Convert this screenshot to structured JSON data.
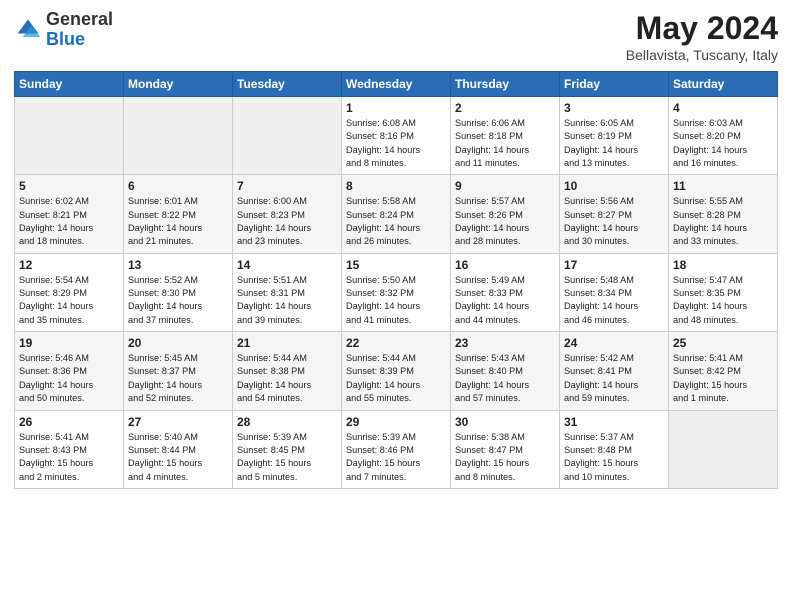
{
  "logo": {
    "general": "General",
    "blue": "Blue"
  },
  "title": "May 2024",
  "subtitle": "Bellavista, Tuscany, Italy",
  "days_of_week": [
    "Sunday",
    "Monday",
    "Tuesday",
    "Wednesday",
    "Thursday",
    "Friday",
    "Saturday"
  ],
  "weeks": [
    [
      {
        "day": "",
        "info": ""
      },
      {
        "day": "",
        "info": ""
      },
      {
        "day": "",
        "info": ""
      },
      {
        "day": "1",
        "info": "Sunrise: 6:08 AM\nSunset: 8:16 PM\nDaylight: 14 hours\nand 8 minutes."
      },
      {
        "day": "2",
        "info": "Sunrise: 6:06 AM\nSunset: 8:18 PM\nDaylight: 14 hours\nand 11 minutes."
      },
      {
        "day": "3",
        "info": "Sunrise: 6:05 AM\nSunset: 8:19 PM\nDaylight: 14 hours\nand 13 minutes."
      },
      {
        "day": "4",
        "info": "Sunrise: 6:03 AM\nSunset: 8:20 PM\nDaylight: 14 hours\nand 16 minutes."
      }
    ],
    [
      {
        "day": "5",
        "info": "Sunrise: 6:02 AM\nSunset: 8:21 PM\nDaylight: 14 hours\nand 18 minutes."
      },
      {
        "day": "6",
        "info": "Sunrise: 6:01 AM\nSunset: 8:22 PM\nDaylight: 14 hours\nand 21 minutes."
      },
      {
        "day": "7",
        "info": "Sunrise: 6:00 AM\nSunset: 8:23 PM\nDaylight: 14 hours\nand 23 minutes."
      },
      {
        "day": "8",
        "info": "Sunrise: 5:58 AM\nSunset: 8:24 PM\nDaylight: 14 hours\nand 26 minutes."
      },
      {
        "day": "9",
        "info": "Sunrise: 5:57 AM\nSunset: 8:26 PM\nDaylight: 14 hours\nand 28 minutes."
      },
      {
        "day": "10",
        "info": "Sunrise: 5:56 AM\nSunset: 8:27 PM\nDaylight: 14 hours\nand 30 minutes."
      },
      {
        "day": "11",
        "info": "Sunrise: 5:55 AM\nSunset: 8:28 PM\nDaylight: 14 hours\nand 33 minutes."
      }
    ],
    [
      {
        "day": "12",
        "info": "Sunrise: 5:54 AM\nSunset: 8:29 PM\nDaylight: 14 hours\nand 35 minutes."
      },
      {
        "day": "13",
        "info": "Sunrise: 5:52 AM\nSunset: 8:30 PM\nDaylight: 14 hours\nand 37 minutes."
      },
      {
        "day": "14",
        "info": "Sunrise: 5:51 AM\nSunset: 8:31 PM\nDaylight: 14 hours\nand 39 minutes."
      },
      {
        "day": "15",
        "info": "Sunrise: 5:50 AM\nSunset: 8:32 PM\nDaylight: 14 hours\nand 41 minutes."
      },
      {
        "day": "16",
        "info": "Sunrise: 5:49 AM\nSunset: 8:33 PM\nDaylight: 14 hours\nand 44 minutes."
      },
      {
        "day": "17",
        "info": "Sunrise: 5:48 AM\nSunset: 8:34 PM\nDaylight: 14 hours\nand 46 minutes."
      },
      {
        "day": "18",
        "info": "Sunrise: 5:47 AM\nSunset: 8:35 PM\nDaylight: 14 hours\nand 48 minutes."
      }
    ],
    [
      {
        "day": "19",
        "info": "Sunrise: 5:46 AM\nSunset: 8:36 PM\nDaylight: 14 hours\nand 50 minutes."
      },
      {
        "day": "20",
        "info": "Sunrise: 5:45 AM\nSunset: 8:37 PM\nDaylight: 14 hours\nand 52 minutes."
      },
      {
        "day": "21",
        "info": "Sunrise: 5:44 AM\nSunset: 8:38 PM\nDaylight: 14 hours\nand 54 minutes."
      },
      {
        "day": "22",
        "info": "Sunrise: 5:44 AM\nSunset: 8:39 PM\nDaylight: 14 hours\nand 55 minutes."
      },
      {
        "day": "23",
        "info": "Sunrise: 5:43 AM\nSunset: 8:40 PM\nDaylight: 14 hours\nand 57 minutes."
      },
      {
        "day": "24",
        "info": "Sunrise: 5:42 AM\nSunset: 8:41 PM\nDaylight: 14 hours\nand 59 minutes."
      },
      {
        "day": "25",
        "info": "Sunrise: 5:41 AM\nSunset: 8:42 PM\nDaylight: 15 hours\nand 1 minute."
      }
    ],
    [
      {
        "day": "26",
        "info": "Sunrise: 5:41 AM\nSunset: 8:43 PM\nDaylight: 15 hours\nand 2 minutes."
      },
      {
        "day": "27",
        "info": "Sunrise: 5:40 AM\nSunset: 8:44 PM\nDaylight: 15 hours\nand 4 minutes."
      },
      {
        "day": "28",
        "info": "Sunrise: 5:39 AM\nSunset: 8:45 PM\nDaylight: 15 hours\nand 5 minutes."
      },
      {
        "day": "29",
        "info": "Sunrise: 5:39 AM\nSunset: 8:46 PM\nDaylight: 15 hours\nand 7 minutes."
      },
      {
        "day": "30",
        "info": "Sunrise: 5:38 AM\nSunset: 8:47 PM\nDaylight: 15 hours\nand 8 minutes."
      },
      {
        "day": "31",
        "info": "Sunrise: 5:37 AM\nSunset: 8:48 PM\nDaylight: 15 hours\nand 10 minutes."
      },
      {
        "day": "",
        "info": ""
      }
    ]
  ]
}
